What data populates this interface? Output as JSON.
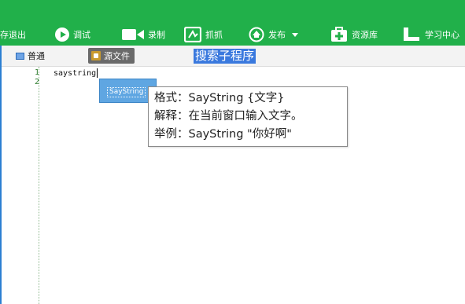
{
  "toolbar": {
    "bg": "#21b04a",
    "items": [
      {
        "label": "存退出"
      },
      {
        "label": "调试",
        "icon": "play-circle-icon"
      },
      {
        "label": "录制",
        "icon": "video-camera-icon"
      },
      {
        "label": "抓抓",
        "icon": "grab-icon"
      },
      {
        "label": "发布",
        "icon": "publish-icon"
      },
      {
        "label": "资源库",
        "icon": "resource-library-icon"
      },
      {
        "label": "学习中心",
        "icon": "learning-center-icon"
      }
    ]
  },
  "tabs": {
    "normal": "普通",
    "source": "源文件"
  },
  "search": {
    "text": "搜索子程序",
    "highlight": "#3a79de"
  },
  "editor": {
    "line_numbers": [
      "1",
      "2"
    ],
    "lines": [
      "saystring",
      ""
    ]
  },
  "autocomplete": {
    "items": [
      "SayString"
    ],
    "bg": "#5fa6e2"
  },
  "tooltip": {
    "format": "格式：SayString {文字}",
    "explain": "解释：在当前窗口输入文字。",
    "example": "举例：SayString \"你好啊\""
  }
}
